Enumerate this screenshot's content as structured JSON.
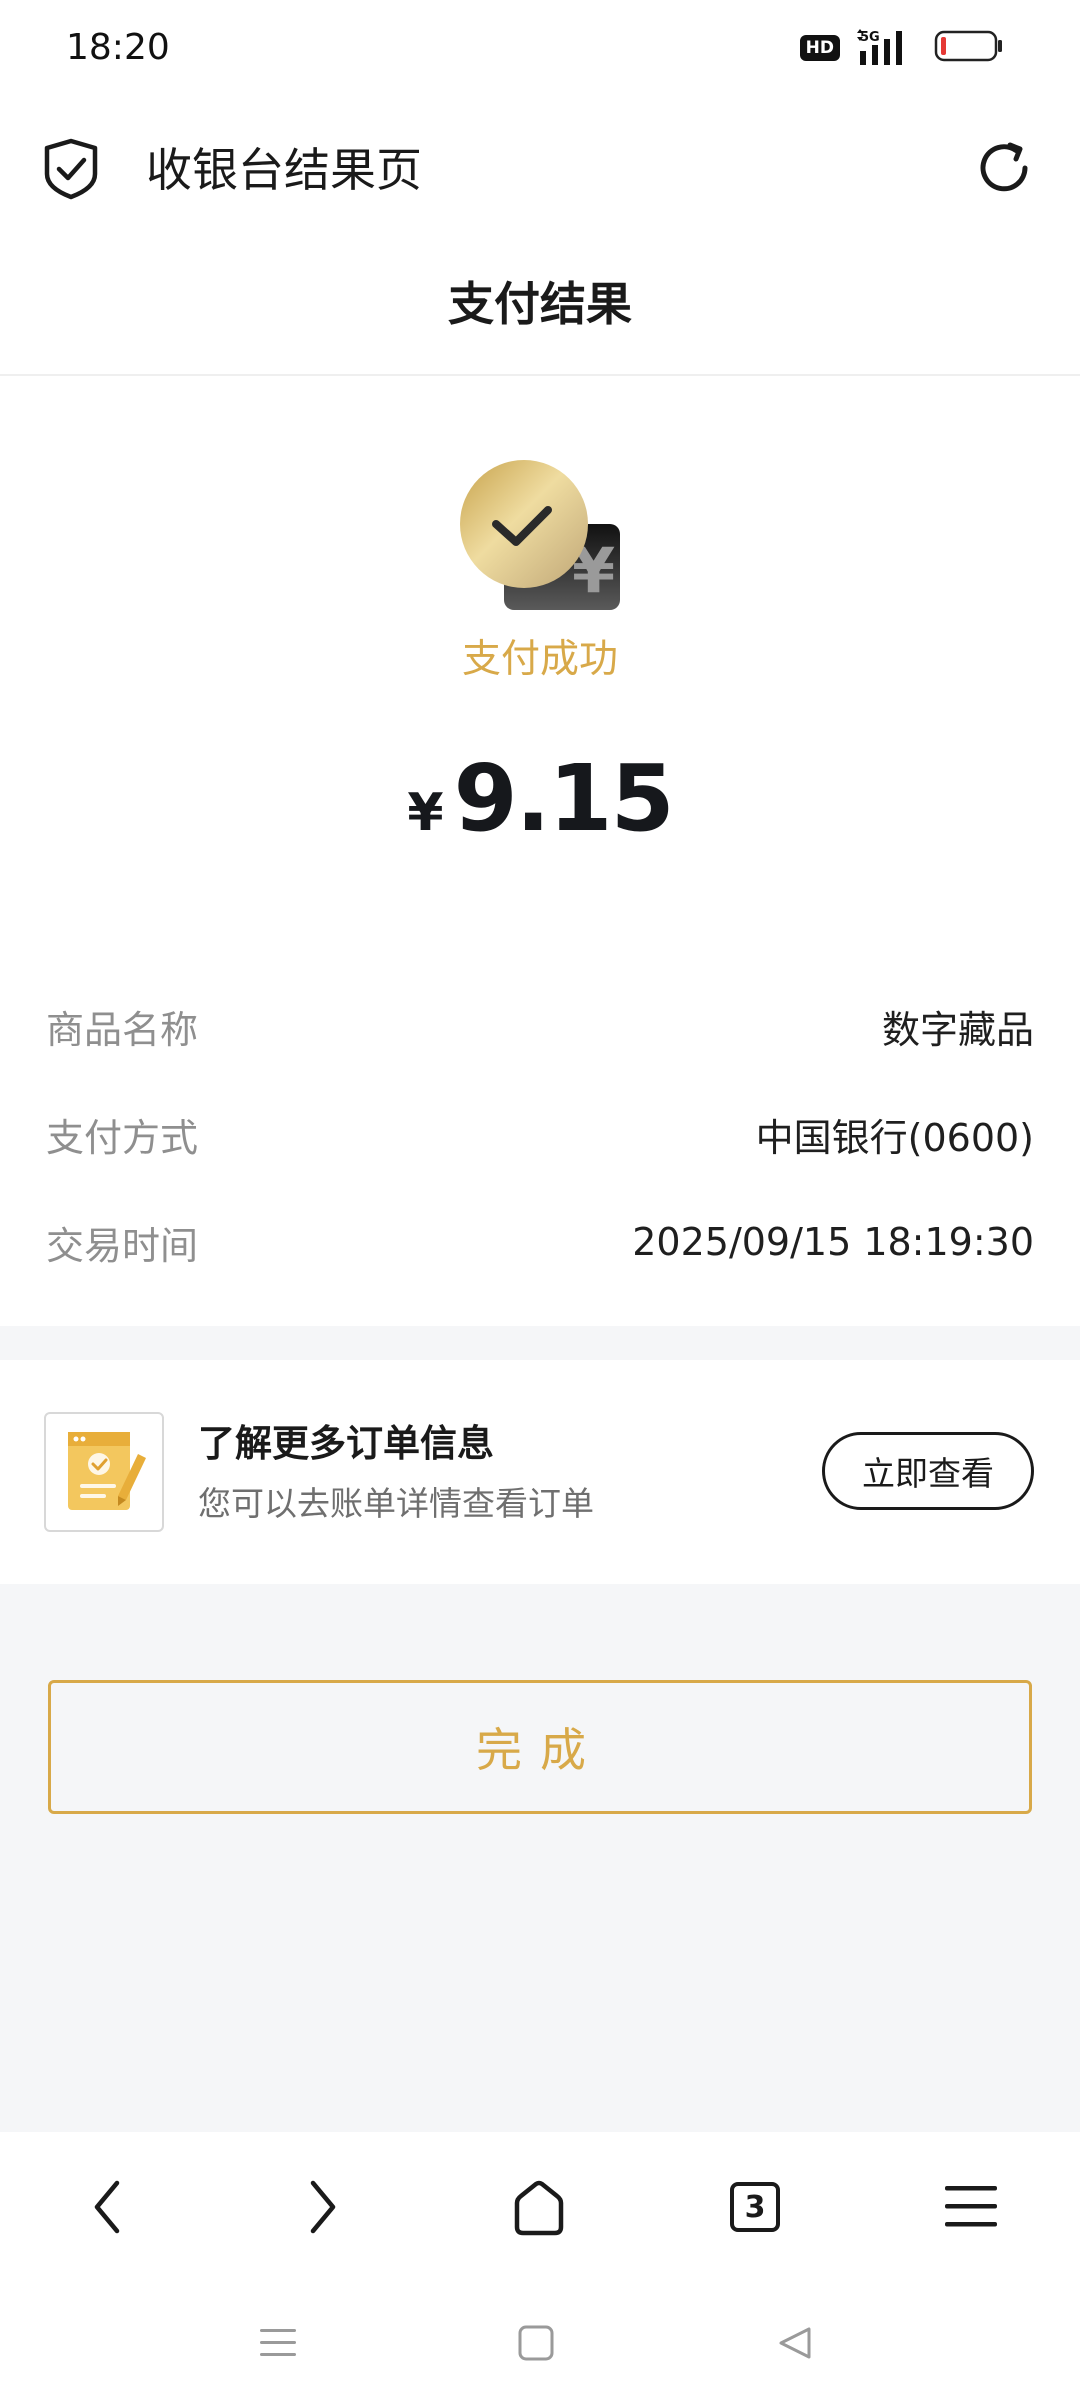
{
  "status_bar": {
    "time": "18:20",
    "hd_label": "HD",
    "network_label": "5G",
    "icons": [
      "hd-icon",
      "5g-signal-icon",
      "battery-low-icon"
    ]
  },
  "browser": {
    "title": "收银台结果页",
    "icons": [
      "shield-check-icon",
      "reload-icon"
    ]
  },
  "page": {
    "title": "支付结果"
  },
  "result": {
    "status": "支付成功",
    "currency_symbol": "¥",
    "amount": "9.15",
    "icon": "payment-success-icon"
  },
  "details": [
    {
      "label": "商品名称",
      "value": "数字藏品"
    },
    {
      "label": "支付方式",
      "value": "中国银行(0600)"
    },
    {
      "label": "交易时间",
      "value": "2025/09/15 18:19:30"
    }
  ],
  "order_info": {
    "title": "了解更多订单信息",
    "subtitle": "您可以去账单详情查看订单",
    "button_label": "立即查看",
    "icon": "order-document-icon"
  },
  "done_button": {
    "label": "完成"
  },
  "browser_nav": {
    "tab_count": "3",
    "icons": [
      "back-icon",
      "forward-icon",
      "home-icon",
      "tabs-icon",
      "menu-icon"
    ]
  },
  "system_nav": {
    "icons": [
      "recent-apps-icon",
      "home-square-icon",
      "back-triangle-icon"
    ]
  },
  "colors": {
    "accent_gold": "#d8a949",
    "text_primary": "#1a1a1a",
    "text_secondary": "#8f8f8f",
    "background_grey": "#f5f6f8"
  }
}
